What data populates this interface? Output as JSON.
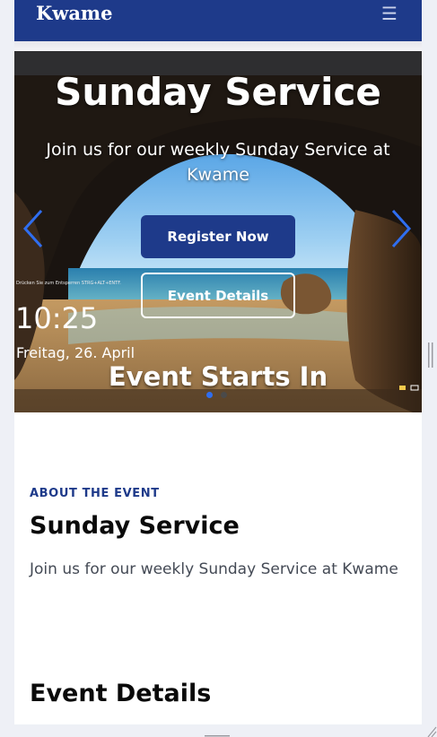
{
  "navbar": {
    "brand": "Kwame",
    "menu_icon": "hamburger-menu-icon"
  },
  "hero": {
    "title": "Sunday Service",
    "subtitle": "Join us for our weekly Sunday Service at Kwame",
    "register_label": "Register Now",
    "details_label": "Event Details",
    "countdown_title": "Event Starts In",
    "prev_icon": "chevron-left-icon",
    "next_icon": "chevron-right-icon",
    "active_slide": 1,
    "slide_count": 2,
    "image": {
      "lock_hint": "Drücken Sie zum Entsperren STRG+ALT+ENTF.",
      "lock_time": "10:25",
      "lock_date": "Freitag, 26. April"
    }
  },
  "about": {
    "eyebrow": "ABOUT THE EVENT",
    "title": "Sunday Service",
    "description": "Join us for our weekly Sunday Service at Kwame"
  },
  "details": {
    "title": "Event Details"
  },
  "colors": {
    "primary": "#1e3a8a",
    "arrow": "#2f6ef0",
    "text_dark": "#0a0a0a",
    "text_muted": "#444a55"
  }
}
